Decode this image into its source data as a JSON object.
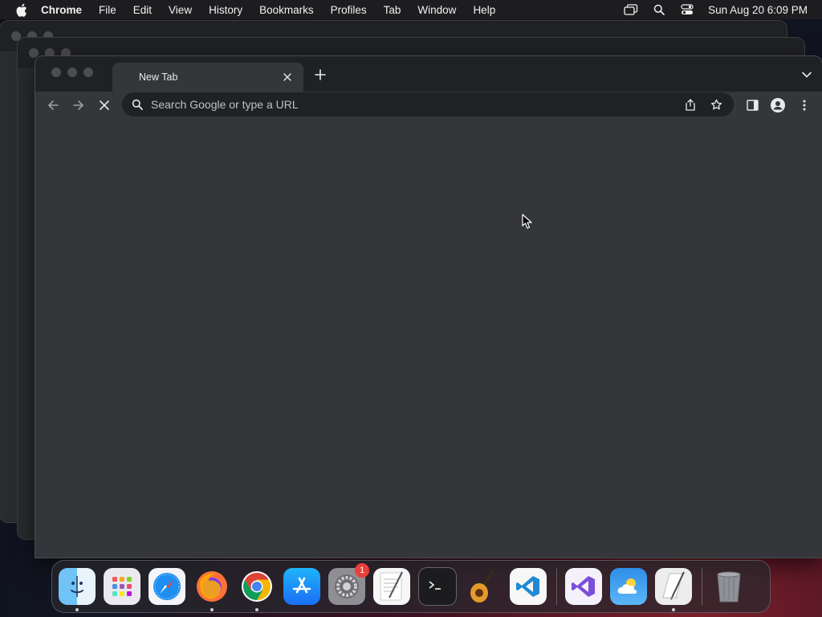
{
  "menubar": {
    "app_name": "Chrome",
    "items": [
      "File",
      "Edit",
      "View",
      "History",
      "Bookmarks",
      "Profiles",
      "Tab",
      "Window",
      "Help"
    ],
    "clock": "Sun Aug 20  6:09 PM",
    "status_icons": [
      "screen-mirroring-icon",
      "spotlight-search-icon",
      "control-center-icon"
    ]
  },
  "browser": {
    "tab": {
      "title": "New Tab",
      "close_icon": "close-icon"
    },
    "new_tab_icon": "plus-icon",
    "tab_search_icon": "chevron-down-icon",
    "toolbar": {
      "back_icon": "back-arrow-icon",
      "forward_icon": "forward-arrow-icon",
      "stop_icon": "stop-loading-icon",
      "omnibox_placeholder": "Search Google or type a URL",
      "omnibox_value": "",
      "share_icon": "share-icon",
      "bookmark_icon": "star-icon",
      "side_panel_icon": "side-panel-icon",
      "profile_icon": "profile-icon",
      "menu_icon": "more-vert-icon"
    }
  },
  "dock": {
    "apps": [
      {
        "name": "Finder",
        "icon": "finder-icon",
        "running": true
      },
      {
        "name": "Launchpad",
        "icon": "launchpad-icon",
        "running": false
      },
      {
        "name": "Safari",
        "icon": "safari-icon",
        "running": false
      },
      {
        "name": "Firefox",
        "icon": "firefox-icon",
        "running": true
      },
      {
        "name": "Chrome",
        "icon": "chrome-icon",
        "running": true
      },
      {
        "name": "App Store",
        "icon": "app-store-icon",
        "running": false
      },
      {
        "name": "System Settings",
        "icon": "system-settings-icon",
        "running": false,
        "badge": "1"
      },
      {
        "name": "TextEdit",
        "icon": "textedit-icon",
        "running": false
      },
      {
        "name": "Terminal",
        "icon": "terminal-icon",
        "running": false
      },
      {
        "name": "GarageBand",
        "icon": "garageband-icon",
        "running": false
      },
      {
        "name": "Visual Studio Code",
        "icon": "vscode-icon",
        "running": false
      },
      {
        "name": "Visual Studio",
        "icon": "visual-studio-icon",
        "running": false
      },
      {
        "name": "Weather",
        "icon": "weather-icon",
        "running": false
      },
      {
        "name": "Script Editor",
        "icon": "script-editor-icon",
        "running": true
      },
      {
        "name": "Trash",
        "icon": "trash-icon",
        "running": false
      }
    ]
  },
  "colors": {
    "window_bg": "#35363a",
    "tabstrip_bg": "#202124",
    "omnibox_bg": "#202124",
    "text": "#e8eaed",
    "badge": "#e8403a"
  }
}
